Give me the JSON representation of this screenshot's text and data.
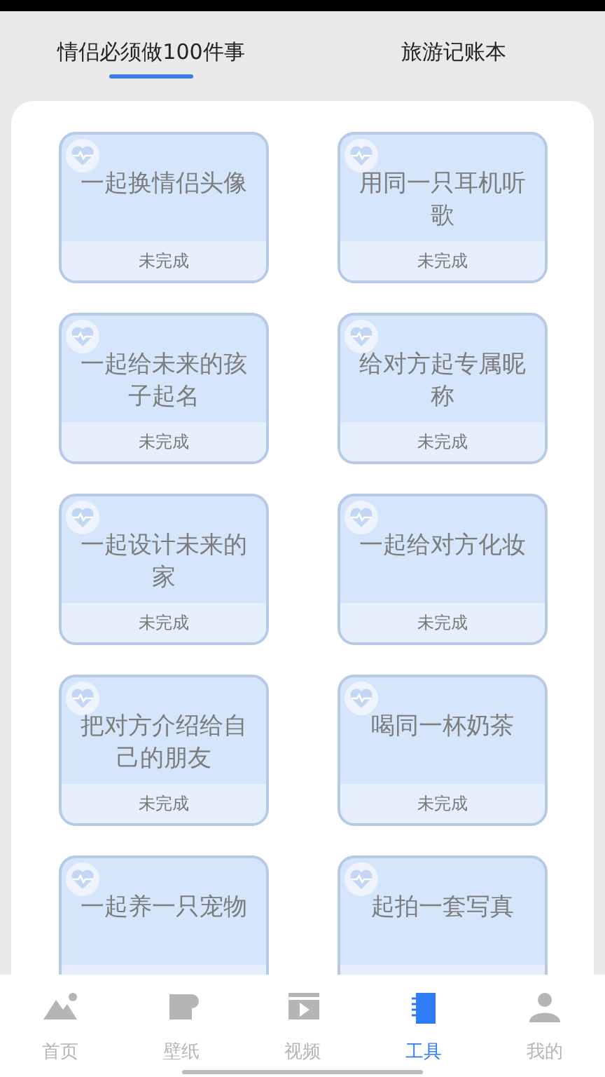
{
  "tabs": [
    {
      "label": "情侣必须做100件事",
      "selected": true
    },
    {
      "label": "旅游记账本",
      "selected": false
    }
  ],
  "cards": [
    {
      "title": "一起换情侣头像",
      "status": "未完成"
    },
    {
      "title": "用同一只耳机听歌",
      "status": "未完成"
    },
    {
      "title": "一起给未来的孩子起名",
      "status": "未完成"
    },
    {
      "title": "给对方起专属昵称",
      "status": "未完成"
    },
    {
      "title": "一起设计未来的家",
      "status": "未完成"
    },
    {
      "title": "一起给对方化妆",
      "status": "未完成"
    },
    {
      "title": "把对方介绍给自己的朋友",
      "status": "未完成"
    },
    {
      "title": "喝同一杯奶茶",
      "status": "未完成"
    },
    {
      "title": "一起养一只宠物"
    },
    {
      "title": "起拍一套写真"
    }
  ],
  "nav": [
    {
      "label": "首页",
      "kind": "home",
      "selected": false
    },
    {
      "label": "壁纸",
      "kind": "wallpaper",
      "selected": false
    },
    {
      "label": "视频",
      "kind": "video",
      "selected": false
    },
    {
      "label": "工具",
      "kind": "tools",
      "selected": true
    },
    {
      "label": "我的",
      "kind": "profile",
      "selected": false
    }
  ]
}
